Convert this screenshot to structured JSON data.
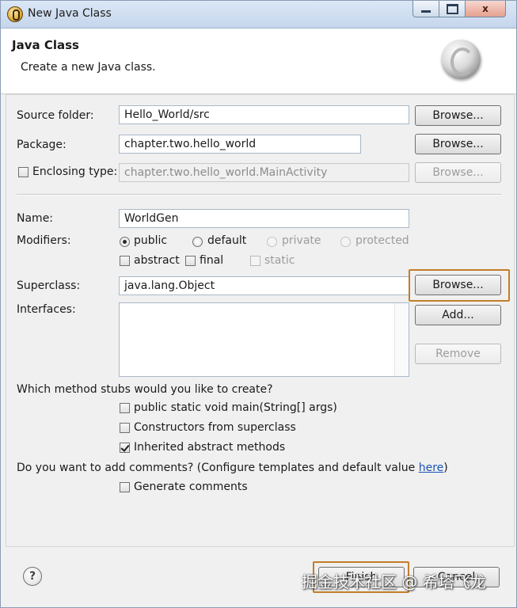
{
  "window": {
    "title": "New Java Class",
    "close_glyph": "x"
  },
  "header": {
    "title": "Java Class",
    "description": "Create a new Java class."
  },
  "form": {
    "source_folder": {
      "label": "Source folder:",
      "value": "Hello_World/src",
      "browse": "Browse..."
    },
    "package": {
      "label": "Package:",
      "value": "chapter.two.hello_world",
      "browse": "Browse..."
    },
    "enclosing_type": {
      "label": "Enclosing type:",
      "value": "chapter.two.hello_world.MainActivity",
      "browse": "Browse...",
      "checked": false
    },
    "name": {
      "label": "Name:",
      "value": "WorldGen"
    },
    "modifiers": {
      "label": "Modifiers:",
      "access": [
        {
          "label": "public",
          "selected": true,
          "enabled": true
        },
        {
          "label": "default",
          "selected": false,
          "enabled": true
        },
        {
          "label": "private",
          "selected": false,
          "enabled": false
        },
        {
          "label": "protected",
          "selected": false,
          "enabled": false
        }
      ],
      "flags": [
        {
          "label": "abstract",
          "checked": false,
          "enabled": true
        },
        {
          "label": "final",
          "checked": false,
          "enabled": true
        },
        {
          "label": "static",
          "checked": false,
          "enabled": false
        }
      ]
    },
    "superclass": {
      "label": "Superclass:",
      "value": "java.lang.Object",
      "browse": "Browse..."
    },
    "interfaces": {
      "label": "Interfaces:",
      "add": "Add...",
      "remove": "Remove"
    },
    "stubs": {
      "question": "Which method stubs would you like to create?",
      "options": [
        {
          "label": "public static void main(String[] args)",
          "checked": false
        },
        {
          "label": "Constructors from superclass",
          "checked": false
        },
        {
          "label": "Inherited abstract methods",
          "checked": true
        }
      ]
    },
    "comments": {
      "question_prefix": "Do you want to add comments? (Configure templates and default value ",
      "link": "here",
      "question_suffix": ")",
      "option": {
        "label": "Generate comments",
        "checked": false
      }
    }
  },
  "footer": {
    "help_glyph": "?",
    "finish": "Finish",
    "cancel": "Cancel",
    "watermark": "掘金技术社区 @ 希塔飞龙"
  },
  "colors": {
    "highlight": "#c37d2a",
    "link": "#1a55b5"
  }
}
